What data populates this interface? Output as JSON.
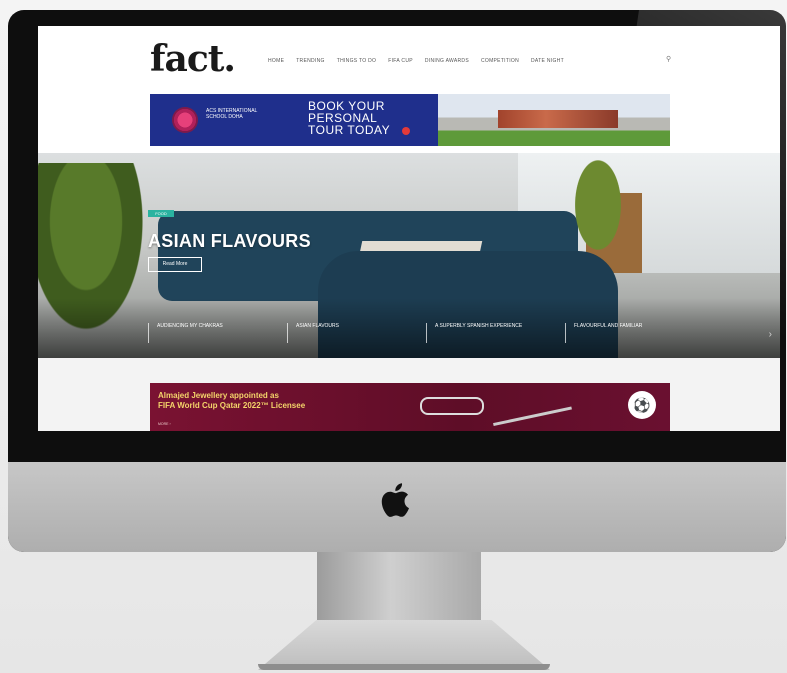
{
  "site": {
    "logo": "fact.",
    "nav": [
      "HOME",
      "TRENDING",
      "THINGS TO DO",
      "FIFA CUP",
      "DINING AWARDS",
      "COMPETITION",
      "DATE NIGHT"
    ],
    "search_icon": "search-icon"
  },
  "ad_top": {
    "school": "ACS INTERNATIONAL SCHOOL DOHA",
    "headline": "BOOK YOUR PERSONAL TOUR TODAY"
  },
  "hero": {
    "tag": "FOOD",
    "title": "ASIAN FLAVOURS",
    "read_more": "Read More",
    "slides": [
      "AUDIENCING MY CHAKRAS",
      "ASIAN FLAVOURS",
      "A SUPERBLY SPANISH EXPERIENCE",
      "FLAVOURFUL AND FAMILIAR"
    ],
    "next_icon": "chevron-right-icon"
  },
  "ad_bottom": {
    "headline_line1": "Almajed Jewellery appointed as",
    "headline_line2": "FIFA World Cup Qatar 2022™ Licensee",
    "more": "MORE ›",
    "badge_icon": "fifa-emblem-icon"
  },
  "device": {
    "logo_icon": "apple-icon"
  }
}
